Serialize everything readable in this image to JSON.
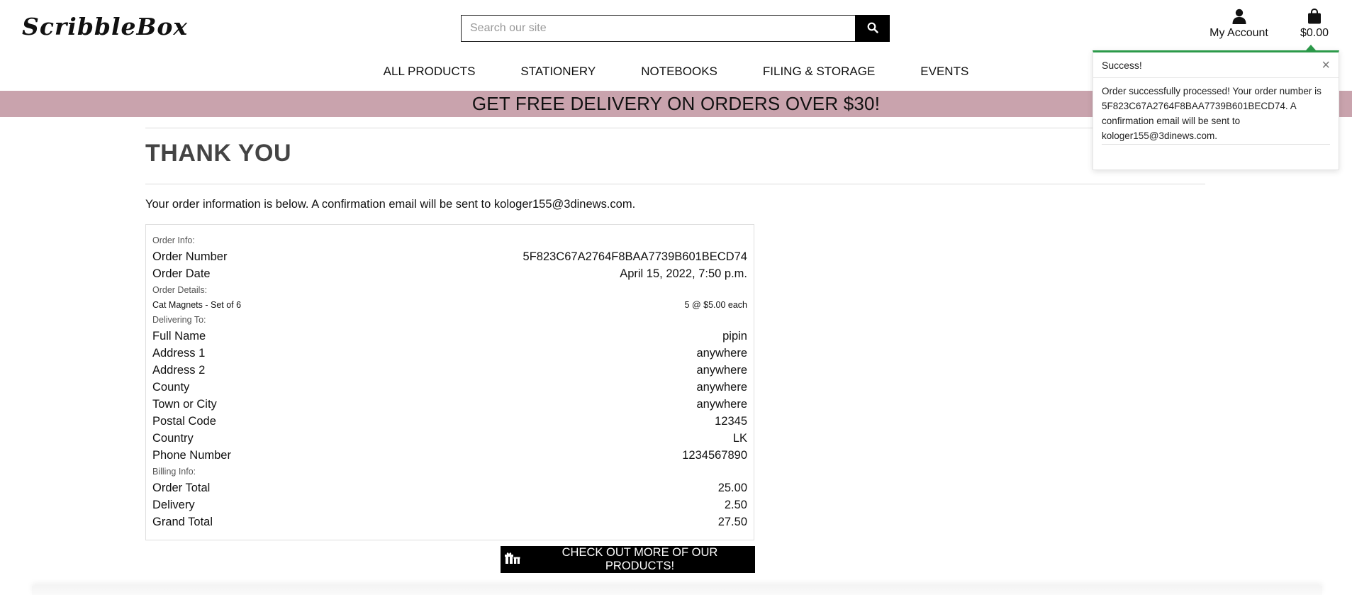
{
  "header": {
    "logo": "ScribbleBox",
    "search_placeholder": "Search our site",
    "account_label": "My Account",
    "cart_total": "$0.00"
  },
  "nav": {
    "items": [
      "ALL PRODUCTS",
      "STATIONERY",
      "NOTEBOOKS",
      "FILING & STORAGE",
      "EVENTS"
    ]
  },
  "banner": {
    "text": "GET FREE DELIVERY ON ORDERS OVER $30!"
  },
  "main": {
    "title": "THANK YOU",
    "intro": "Your order information is below. A confirmation email will be sent to kologer155@3dinews.com.",
    "order_info_label": "Order Info:",
    "order_number_label": "Order Number",
    "order_number": "5F823C67A2764F8BAA7739B601BECD74",
    "order_date_label": "Order Date",
    "order_date": "April 15, 2022, 7:50 p.m.",
    "order_details_label": "Order Details:",
    "line_item_name": "Cat Magnets - Set of 6",
    "line_item_qty": "5 @ $5.00 each",
    "delivering_label": "Delivering To:",
    "delivery": {
      "full_name_label": "Full Name",
      "full_name": "pipin",
      "address1_label": "Address 1",
      "address1": "anywhere",
      "address2_label": "Address 2",
      "address2": "anywhere",
      "county_label": "County",
      "county": "anywhere",
      "town_label": "Town or City",
      "town": "anywhere",
      "postal_label": "Postal Code",
      "postal": "12345",
      "country_label": "Country",
      "country": "LK",
      "phone_label": "Phone Number",
      "phone": "1234567890"
    },
    "billing_label": "Billing Info:",
    "billing": {
      "order_total_label": "Order Total",
      "order_total": "25.00",
      "delivery_label": "Delivery",
      "delivery": "2.50",
      "grand_total_label": "Grand Total",
      "grand_total": "27.50"
    },
    "cta_label": "CHECK OUT MORE OF OUR PRODUCTS!"
  },
  "toast": {
    "title": "Success!",
    "close": "×",
    "message": "Order successfully processed! Your order number is 5F823C67A2764F8BAA7739B601BECD74. A confirmation email will be sent to kologer155@3dinews.com.",
    "accent_color": "#2c9a4a"
  },
  "colors": {
    "banner_bg": "#c9a3ad",
    "button_bg": "#000000"
  },
  "icons": {
    "search": "search-icon",
    "account": "user-icon",
    "cart": "shopping-bag-icon",
    "cta": "gifts-icon",
    "close": "close-icon"
  }
}
